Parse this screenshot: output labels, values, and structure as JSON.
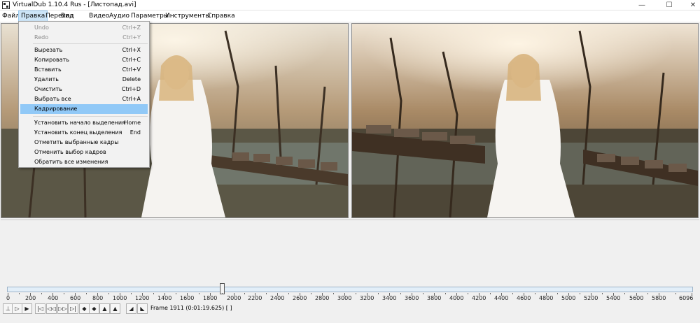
{
  "window": {
    "title": "VirtualDub 1.10.4 Rus - [Листопад.avi]"
  },
  "menubar": [
    {
      "id": "file",
      "label": "Файл"
    },
    {
      "id": "edit",
      "label": "Правка",
      "active": true
    },
    {
      "id": "go",
      "label": "Переход"
    },
    {
      "id": "view",
      "label": "Вид"
    },
    {
      "id": "video",
      "label": "Видео"
    },
    {
      "id": "audio",
      "label": "Аудио"
    },
    {
      "id": "options",
      "label": "Параметры"
    },
    {
      "id": "tools",
      "label": "Инструменты"
    },
    {
      "id": "help",
      "label": "Справка"
    }
  ],
  "edit_menu": [
    {
      "label": "Undo",
      "shortcut": "Ctrl+Z",
      "disabled": true
    },
    {
      "label": "Redo",
      "shortcut": "Ctrl+Y",
      "disabled": true
    },
    {
      "separator": true
    },
    {
      "label": "Вырезать",
      "shortcut": "Ctrl+X"
    },
    {
      "label": "Копировать",
      "shortcut": "Ctrl+C"
    },
    {
      "label": "Вставить",
      "shortcut": "Ctrl+V"
    },
    {
      "label": "Удалить",
      "shortcut": "Delete"
    },
    {
      "label": "Очистить",
      "shortcut": "Ctrl+D"
    },
    {
      "label": "Выбрать все",
      "shortcut": "Ctrl+A"
    },
    {
      "label": "Кадрирование",
      "shortcut": "",
      "highlighted": true
    },
    {
      "separator": true
    },
    {
      "label": "Установить начало выделения",
      "shortcut": "Home"
    },
    {
      "label": "Установить конец выделения",
      "shortcut": "End"
    },
    {
      "label": "Отметить выбранные кадры",
      "shortcut": ""
    },
    {
      "label": "Отменить выбор кадров",
      "shortcut": ""
    },
    {
      "label": "Обратить все изменения",
      "shortcut": ""
    }
  ],
  "timeline": {
    "ticks": [
      "0",
      "200",
      "400",
      "600",
      "800",
      "1000",
      "1200",
      "1400",
      "1600",
      "1800",
      "2000",
      "2200",
      "2400",
      "2600",
      "2800",
      "3000",
      "3200",
      "3400",
      "3600",
      "3800",
      "4000",
      "4200",
      "4400",
      "4600",
      "4800",
      "5000",
      "5200",
      "5400",
      "5600",
      "5800",
      "6096"
    ],
    "max_frame": 6096,
    "current_frame": 1911
  },
  "status": {
    "frame_text": "Frame 1911 (0:01:19.625) [ ]"
  },
  "toolbar": [
    {
      "name": "stop-button",
      "glyph": "⊥"
    },
    {
      "name": "play-input-button",
      "glyph": "▷"
    },
    {
      "name": "play-output-button",
      "glyph": "▶"
    },
    {
      "name": "go-start-button",
      "glyph": "|◁"
    },
    {
      "name": "prev-frame-button",
      "glyph": "◁◁"
    },
    {
      "name": "next-frame-button",
      "glyph": "▷▷"
    },
    {
      "name": "go-end-button",
      "glyph": "▷|"
    },
    {
      "name": "prev-keyframe-button",
      "glyph": "◆"
    },
    {
      "name": "next-keyframe-button",
      "glyph": "◆"
    },
    {
      "name": "scene-back-button",
      "glyph": "▲"
    },
    {
      "name": "scene-forward-button",
      "glyph": "▲"
    },
    {
      "name": "mark-in-button",
      "glyph": "◢"
    },
    {
      "name": "mark-out-button",
      "glyph": "◣"
    }
  ],
  "colors": {
    "accent": "#91c9f7",
    "menu_active": "#cce4f7"
  }
}
